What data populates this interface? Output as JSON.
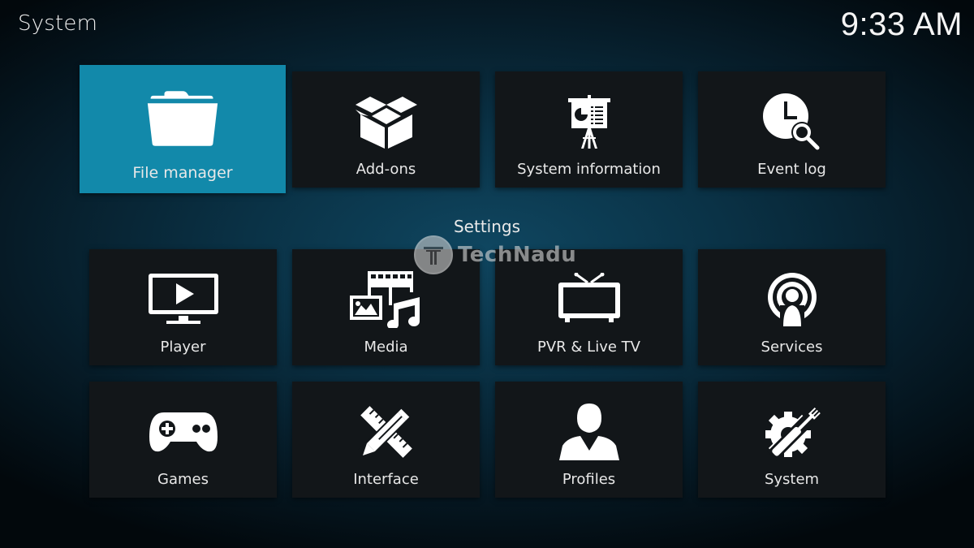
{
  "header": {
    "title": "System",
    "clock": "9:33 AM"
  },
  "top_row": [
    {
      "label": "File manager",
      "icon": "folder-icon",
      "focused": true
    },
    {
      "label": "Add-ons",
      "icon": "open-box-icon",
      "focused": false
    },
    {
      "label": "System information",
      "icon": "presentation-easel-icon",
      "focused": false
    },
    {
      "label": "Event log",
      "icon": "clock-search-icon",
      "focused": false
    }
  ],
  "settings": {
    "heading": "Settings",
    "items": [
      {
        "label": "Player",
        "icon": "monitor-play-icon"
      },
      {
        "label": "Media",
        "icon": "media-collage-icon"
      },
      {
        "label": "PVR & Live TV",
        "icon": "tv-antenna-icon"
      },
      {
        "label": "Services",
        "icon": "broadcast-user-icon"
      },
      {
        "label": "Games",
        "icon": "gamepad-icon"
      },
      {
        "label": "Interface",
        "icon": "pencil-ruler-icon"
      },
      {
        "label": "Profiles",
        "icon": "user-silhouette-icon"
      },
      {
        "label": "System",
        "icon": "gear-screwdriver-icon"
      }
    ]
  },
  "watermark": {
    "text": "TechNadu"
  },
  "colors": {
    "focus_tile": "#1289aa",
    "tile_bg": "#121619",
    "background": "#0a3246"
  }
}
